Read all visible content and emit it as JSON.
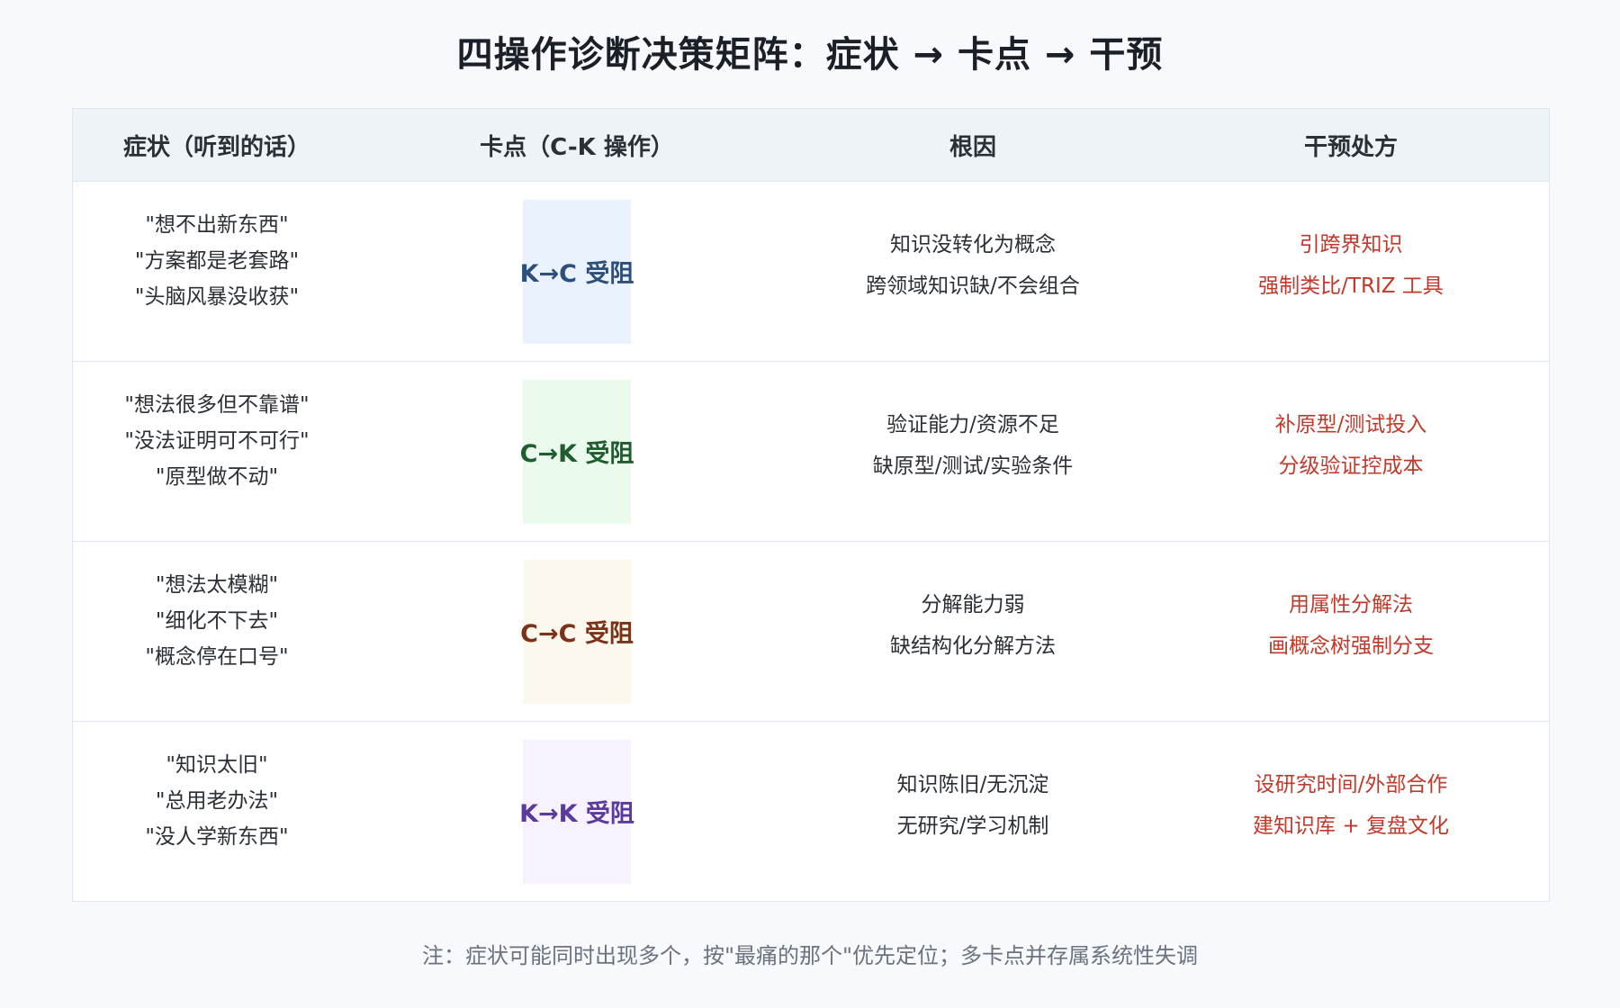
{
  "title": "四操作诊断决策矩阵：症状 → 卡点 → 干预",
  "headers": {
    "symptom": "症状（听到的话）",
    "blocker": "卡点（C-K 操作）",
    "root_cause": "根因",
    "intervention": "干预处方"
  },
  "rows": [
    {
      "symptoms": [
        "\"想不出新东西\"",
        "\"方案都是老套路\"",
        "\"头脑风暴没收获\""
      ],
      "blocker": "K→C 受阻",
      "blocker_color": "#2c4f7c",
      "blocker_bg": "#eaf3fd",
      "root_cause": [
        "知识没转化为概念",
        "跨领域知识缺/不会组合"
      ],
      "intervention": [
        "引跨界知识",
        "强制类比/TRIZ 工具"
      ]
    },
    {
      "symptoms": [
        "\"想法很多但不靠谱\"",
        "\"没法证明可不可行\"",
        "\"原型做不动\""
      ],
      "blocker": "C→K 受阻",
      "blocker_color": "#1f5c2e",
      "blocker_bg": "#eafbee",
      "root_cause": [
        "验证能力/资源不足",
        "缺原型/测试/实验条件"
      ],
      "intervention": [
        "补原型/测试投入",
        "分级验证控成本"
      ]
    },
    {
      "symptoms": [
        "\"想法太模糊\"",
        "\"细化不下去\"",
        "\"概念停在口号\""
      ],
      "blocker": "C→C 受阻",
      "blocker_color": "#7a3318",
      "blocker_bg": "#fdf8ee",
      "root_cause": [
        "分解能力弱",
        "缺结构化分解方法"
      ],
      "intervention": [
        "用属性分解法",
        "画概念树强制分支"
      ]
    },
    {
      "symptoms": [
        "\"知识太旧\"",
        "\"总用老办法\"",
        "\"没人学新东西\""
      ],
      "blocker": "K→K 受阻",
      "blocker_color": "#5b3a9e",
      "blocker_bg": "#f7f2fd",
      "root_cause": [
        "知识陈旧/无沉淀",
        "无研究/学习机制"
      ],
      "intervention": [
        "设研究时间/外部合作",
        "建知识库 + 复盘文化"
      ]
    }
  ],
  "note": "注：症状可能同时出现多个，按\"最痛的那个\"优先定位；多卡点并存属系统性失调"
}
